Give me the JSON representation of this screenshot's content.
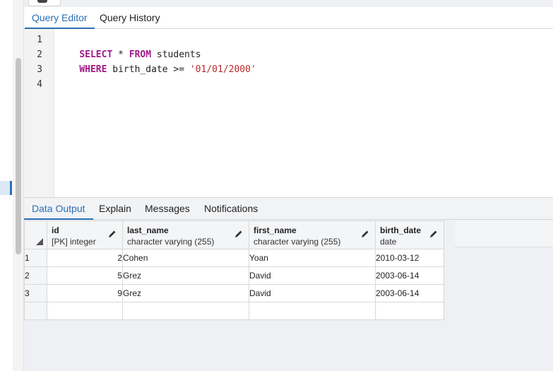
{
  "editor_tabs": [
    {
      "label": "Query Editor",
      "active": true
    },
    {
      "label": "Query History",
      "active": false
    }
  ],
  "editor": {
    "line_numbers": [
      "1",
      "2",
      "3",
      "4"
    ],
    "lines": [
      [
        {
          "t": "kw",
          "text": "SELECT"
        },
        {
          "t": "plain",
          "text": " * "
        },
        {
          "t": "kw",
          "text": "FROM"
        },
        {
          "t": "plain",
          "text": " students"
        }
      ],
      [
        {
          "t": "kw",
          "text": "WHERE"
        },
        {
          "t": "plain",
          "text": " birth_date >= "
        },
        {
          "t": "str",
          "text": "'01/01/2000'"
        }
      ],
      [],
      []
    ]
  },
  "output_tabs": [
    {
      "label": "Data Output",
      "active": true
    },
    {
      "label": "Explain",
      "active": false
    },
    {
      "label": "Messages",
      "active": false
    },
    {
      "label": "Notifications",
      "active": false
    }
  ],
  "result_grid": {
    "columns": [
      {
        "name": "id",
        "type": "[PK] integer"
      },
      {
        "name": "last_name",
        "type": "character varying (255)"
      },
      {
        "name": "first_name",
        "type": "character varying (255)"
      },
      {
        "name": "birth_date",
        "type": "date"
      }
    ],
    "rows": [
      {
        "row": "1",
        "id": "2",
        "last_name": "Cohen",
        "first_name": "Yoan",
        "birth_date": "2010-03-12"
      },
      {
        "row": "2",
        "id": "5",
        "last_name": "Grez",
        "first_name": "David",
        "birth_date": "2003-06-14"
      },
      {
        "row": "3",
        "id": "9",
        "last_name": "Grez",
        "first_name": "David",
        "birth_date": "2003-06-14"
      }
    ]
  },
  "colors": {
    "accent": "#2a6fb5",
    "keyword": "#a3188a",
    "string": "#b8282a"
  }
}
